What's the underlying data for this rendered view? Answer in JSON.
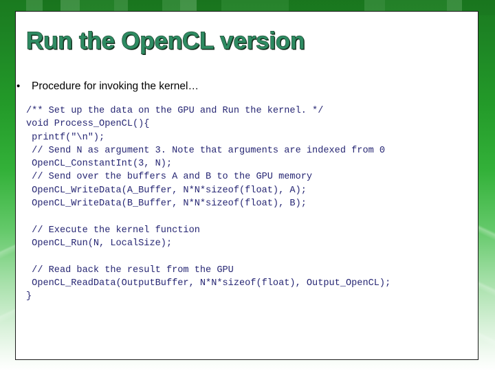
{
  "slide": {
    "title": "Run the OpenCL version",
    "bullet": {
      "marker": "•",
      "text": "Procedure for invoking the kernel…"
    },
    "code_lines": [
      "/** Set up the data on the GPU and Run the kernel. */",
      "void Process_OpenCL(){",
      " printf(\"\\n\");",
      " // Send N as argument 3. Note that arguments are indexed from 0",
      " OpenCL_ConstantInt(3, N);",
      " // Send over the buffers A and B to the GPU memory",
      " OpenCL_WriteData(A_Buffer, N*N*sizeof(float), A);",
      " OpenCL_WriteData(B_Buffer, N*N*sizeof(float), B);",
      "",
      " // Execute the kernel function",
      " OpenCL_Run(N, LocalSize);",
      "",
      " // Read back the result from the GPU",
      " OpenCL_ReadData(OutputBuffer, N*N*sizeof(float), Output_OpenCL);",
      "}"
    ],
    "colors": {
      "title_fill": "#2e8b62",
      "title_outline": "#1d3d2b",
      "code_text": "#262673",
      "background_green_dark": "#1a7a1f",
      "background_green_light": "#ffffff",
      "panel_background": "#ffffff",
      "panel_border": "#1a1a1a",
      "body_text": "#000000"
    }
  }
}
